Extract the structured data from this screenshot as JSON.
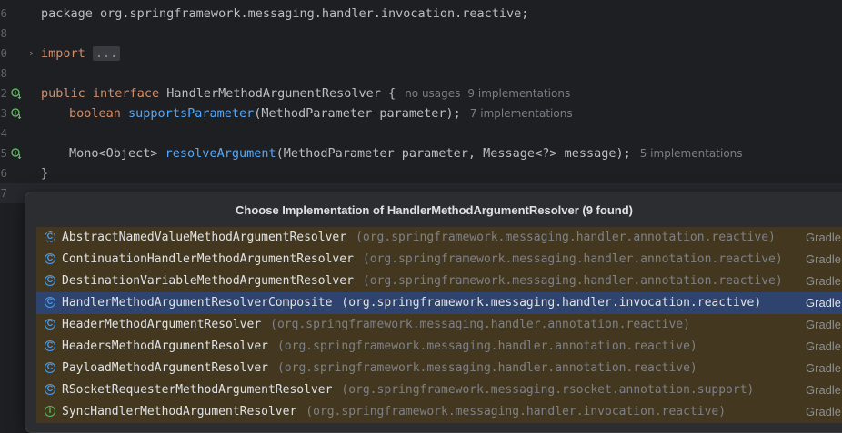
{
  "editor": {
    "lines": {
      "l1": {
        "num": "6",
        "text": "package org.springframework.messaging.handler.invocation.reactive;"
      },
      "l2": {
        "num": "8"
      },
      "l3": {
        "num": "0",
        "kw": "import",
        "collapsed": "..."
      },
      "l4": {
        "num": "8"
      },
      "l5": {
        "num": "2",
        "kw1": "public",
        "kw2": "interface",
        "name": "HandlerMethodArgumentResolver {",
        "hint1": "no usages",
        "hint2": "9 implementations"
      },
      "l6": {
        "num": "3",
        "kw": "boolean",
        "fn": "supportsParameter",
        "rest": "(MethodParameter parameter);",
        "hint": "7 implementations"
      },
      "l7": {
        "num": "4"
      },
      "l8": {
        "num": "5",
        "pre": "Mono<Object> ",
        "fn": "resolveArgument",
        "rest": "(MethodParameter parameter, Message<?> message);",
        "hint": "5 implementations"
      },
      "l9": {
        "num": "6",
        "text": "}"
      },
      "l10": {
        "num": "7"
      }
    }
  },
  "popup": {
    "title": "Choose Implementation of HandlerMethodArgumentResolver (9 found)",
    "items": [
      {
        "icon": "abstract-class-icon",
        "name": "AbstractNamedValueMethodArgumentResolver",
        "pkg": "(org.springframework.messaging.handler.annotation.reactive)",
        "source": "Gradle"
      },
      {
        "icon": "class-icon",
        "name": "ContinuationHandlerMethodArgumentResolver",
        "pkg": "(org.springframework.messaging.handler.annotation.reactive)",
        "source": "Gradle"
      },
      {
        "icon": "class-icon",
        "name": "DestinationVariableMethodArgumentResolver",
        "pkg": "(org.springframework.messaging.handler.annotation.reactive)",
        "source": "Gradle"
      },
      {
        "icon": "class-icon",
        "name": "HandlerMethodArgumentResolverComposite",
        "pkg": "(org.springframework.messaging.handler.invocation.reactive)",
        "source": "Gradle"
      },
      {
        "icon": "class-icon",
        "name": "HeaderMethodArgumentResolver",
        "pkg": "(org.springframework.messaging.handler.annotation.reactive)",
        "source": "Gradle"
      },
      {
        "icon": "class-icon",
        "name": "HeadersMethodArgumentResolver",
        "pkg": "(org.springframework.messaging.handler.annotation.reactive)",
        "source": "Gradle"
      },
      {
        "icon": "class-icon",
        "name": "PayloadMethodArgumentResolver",
        "pkg": "(org.springframework.messaging.handler.annotation.reactive)",
        "source": "Gradle"
      },
      {
        "icon": "class-icon",
        "name": "RSocketRequesterMethodArgumentResolver",
        "pkg": "(org.springframework.messaging.rsocket.annotation.support)",
        "source": "Gradle"
      },
      {
        "icon": "interface-icon",
        "name": "SyncHandlerMethodArgumentResolver",
        "pkg": "(org.springframework.messaging.handler.invocation.reactive)",
        "source": "Gradle"
      }
    ],
    "selected_index": 3
  },
  "colors": {
    "background": "#1e1f22",
    "keyword": "#cf8e6d",
    "function": "#56a8f5",
    "row_highlight": "#43381f",
    "row_selected": "#2e436e"
  }
}
